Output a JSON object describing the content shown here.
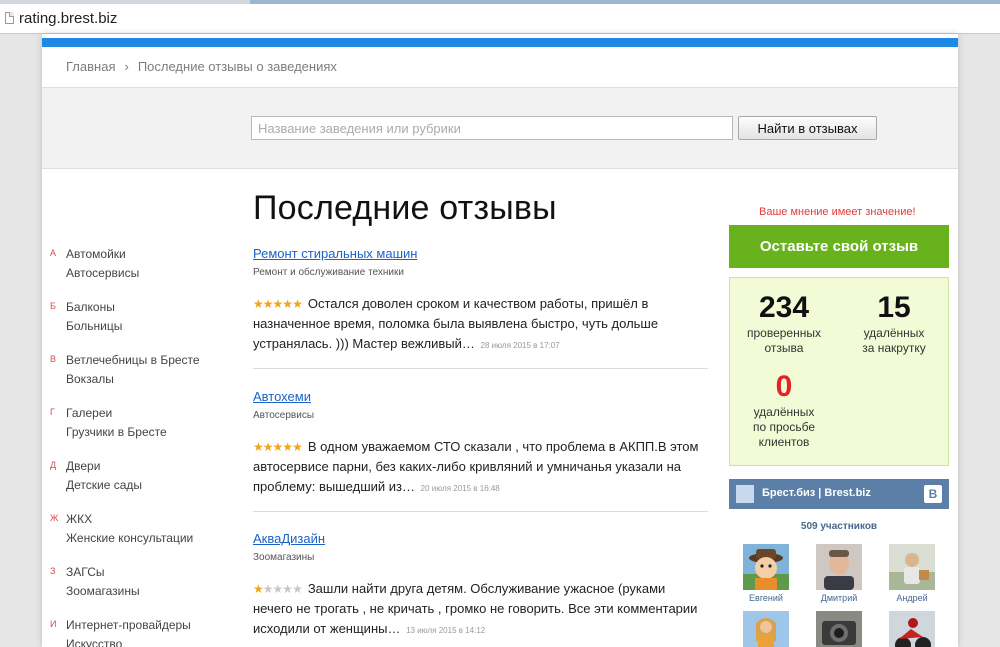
{
  "browser": {
    "url": "rating.brest.biz"
  },
  "breadcrumb": {
    "home": "Главная",
    "separator": "›",
    "current": "Последние отзывы о заведениях"
  },
  "search": {
    "placeholder": "Название заведения или рубрики",
    "button_label": "Найти в отзывах"
  },
  "sidebar": {
    "groups": [
      {
        "letter": "А",
        "links": [
          "Автомойки",
          "Автосервисы"
        ]
      },
      {
        "letter": "Б",
        "links": [
          "Балконы",
          "Больницы"
        ]
      },
      {
        "letter": "В",
        "links": [
          "Ветлечебницы в Бресте",
          "Вокзалы"
        ]
      },
      {
        "letter": "Г",
        "links": [
          "Галереи",
          "Грузчики в Бресте"
        ]
      },
      {
        "letter": "Д",
        "links": [
          "Двери",
          "Детские сады"
        ]
      },
      {
        "letter": "Ж",
        "links": [
          "ЖКХ",
          "Женские консультации"
        ]
      },
      {
        "letter": "З",
        "links": [
          "ЗАГСы",
          "Зоомагазины"
        ]
      },
      {
        "letter": "И",
        "links": [
          "Интернет-провайдеры",
          "Искусство"
        ]
      }
    ]
  },
  "main": {
    "title": "Последние отзывы",
    "reviews": [
      {
        "business": "Ремонт стиральных машин",
        "category": "Ремонт и обслуживание техники",
        "rating": 5,
        "text": "Остался доволен сроком и качеством работы, пришёл в назначенное время, поломка была выявлена быстро, чуть дольше устранялась. ))) Мастер вежливый…",
        "date": "28 июля 2015 в 17:07"
      },
      {
        "business": "Автохеми",
        "category": "Автосервисы",
        "rating": 5,
        "text": "В одном уважаемом СТО сказали , что проблема в АКПП.В этом автосервисе парни, без каких-либо кривляний и умничанья указали на проблему: вышедший из…",
        "date": "20 июля 2015 в 16:48"
      },
      {
        "business": "АкваДизайн",
        "category": "Зоомагазины",
        "rating": 1,
        "text": "Зашли найти друга детям. Обслуживание ужасное (руками нечего не трогать , не кричать , громко не говорить. Все эти комментарии исходили от женщины…",
        "date": "13 июля 2015 в 14:12"
      }
    ]
  },
  "right": {
    "opinion": "Ваше мнение имеет значение!",
    "cta_label": "Оставьте свой отзыв",
    "stats": [
      {
        "value": "234",
        "label_1": "проверенных",
        "label_2": "отзыва",
        "label_3": ""
      },
      {
        "value": "15",
        "label_1": "удалённых",
        "label_2": "за накрутку",
        "label_3": ""
      },
      {
        "value": "0",
        "label_1": "удалённых",
        "label_2": "по просьбе",
        "label_3": "клиентов"
      }
    ],
    "vk": {
      "group_name": "Брест.биз | Brest.biz",
      "badge": "B",
      "members": "509 участников",
      "people": [
        "Евгений",
        "Дмитрий",
        "Андрей"
      ]
    }
  },
  "colors": {
    "accent_blue": "#1e88e5",
    "cta_green": "#67b21d",
    "star": "#f2a51a",
    "link": "#1a63c7",
    "stats_bg": "#f2fbd6",
    "vk_blue": "#5b7fa6"
  }
}
